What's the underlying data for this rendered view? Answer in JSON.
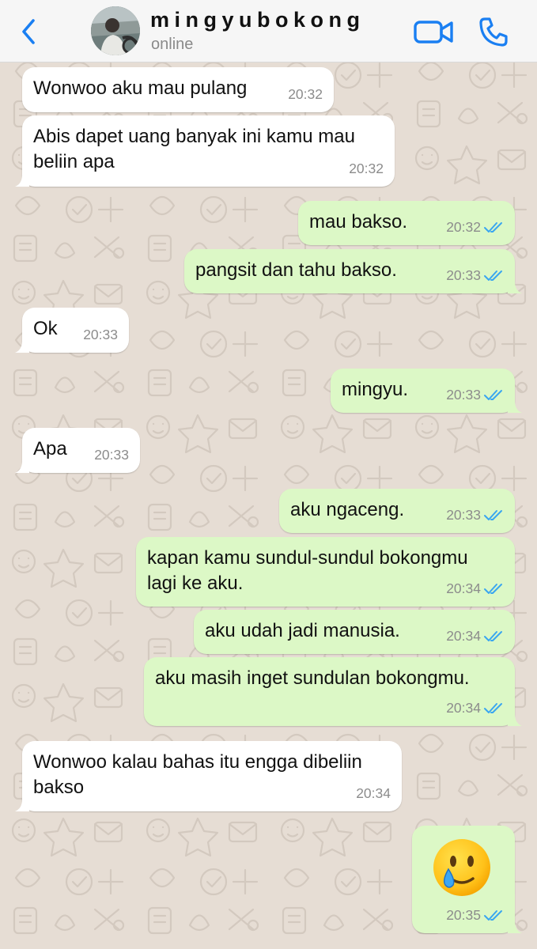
{
  "header": {
    "contact_name": "mingyubokong",
    "status": "online",
    "icons": {
      "back": "chevron-left-icon",
      "video": "video-camera-icon",
      "call": "phone-icon"
    },
    "accent_color": "#1a7ff2"
  },
  "colors": {
    "incoming_bubble": "#ffffff",
    "outgoing_bubble": "#dcf8c6",
    "read_ticks": "#3aa6f0",
    "wallpaper": "#e6ddd4"
  },
  "messages": [
    {
      "direction": "in",
      "text": "Wonwoo aku mau pulang",
      "time": "20:32"
    },
    {
      "direction": "in",
      "text": "Abis dapet uang banyak ini kamu mau beliin apa",
      "time": "20:32"
    },
    {
      "direction": "out",
      "text": "mau bakso.",
      "time": "20:32",
      "status": "read"
    },
    {
      "direction": "out",
      "text": "pangsit dan tahu bakso.",
      "time": "20:33",
      "status": "read"
    },
    {
      "direction": "in",
      "text": "Ok",
      "time": "20:33"
    },
    {
      "direction": "out",
      "text": "mingyu.",
      "time": "20:33",
      "status": "read"
    },
    {
      "direction": "in",
      "text": "Apa",
      "time": "20:33"
    },
    {
      "direction": "out",
      "text": "aku ngaceng.",
      "time": "20:33",
      "status": "read"
    },
    {
      "direction": "out",
      "text": "kapan kamu sundul-sundul bokongmu lagi ke aku.",
      "time": "20:34",
      "status": "read"
    },
    {
      "direction": "out",
      "text": "aku udah jadi manusia.",
      "time": "20:34",
      "status": "read"
    },
    {
      "direction": "out",
      "text": "aku masih inget sundulan bokongmu.",
      "time": "20:34",
      "status": "read"
    },
    {
      "direction": "in",
      "text": "Wonwoo kalau bahas itu engga dibeliin bakso",
      "time": "20:34"
    },
    {
      "direction": "out",
      "text": "",
      "emoji": "smiling-face-with-tear-icon",
      "time": "20:35",
      "status": "read"
    }
  ]
}
